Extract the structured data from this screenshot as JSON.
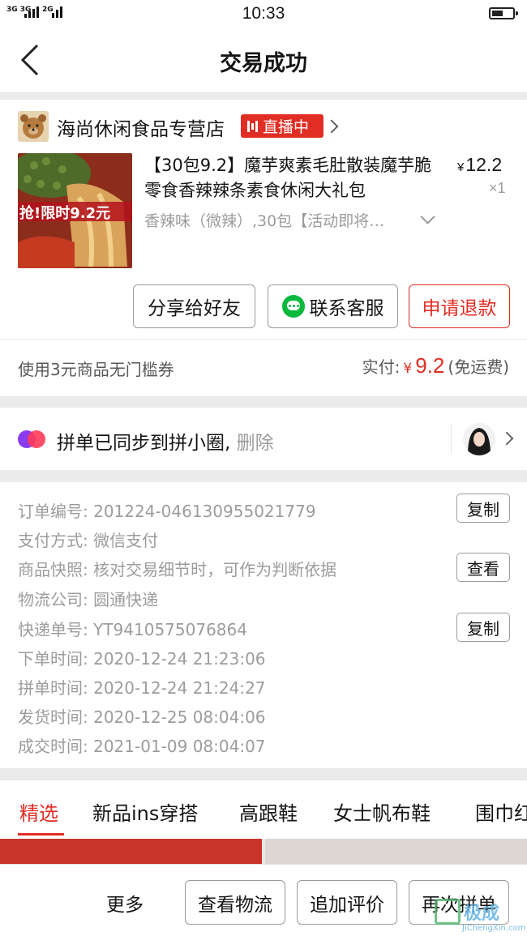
{
  "status_bar": {
    "signal_1": "3G 3G",
    "signal_2": "2G",
    "time": "10:33",
    "battery_icon": "battery-icon"
  },
  "nav": {
    "title": "交易成功",
    "back_icon": "chevron-left-icon"
  },
  "store": {
    "name": "海尚休闲食品专营店",
    "live_label": "直播中"
  },
  "product": {
    "banner": "抢!限时9.2元",
    "title": "【30包9.2】魔芋爽素毛肚散装魔芋脆零食香辣辣条素食休闲大礼包",
    "currency": "¥",
    "price": "12.2",
    "qty": "×1",
    "spec": "香辣味（微辣）,30包【活动即将…"
  },
  "actions": {
    "share": "分享给好友",
    "contact": "联系客服",
    "refund": "申请退款"
  },
  "payment": {
    "coupon": "使用3元商品无门槛券",
    "paid_label": "实付:",
    "currency": "¥",
    "amount": "9.2",
    "shipping": "(免运费)"
  },
  "pinxiaoquan": {
    "text": "拼单已同步到拼小圈,",
    "delete": "删除"
  },
  "order_info": {
    "order_no_label": "订单编号:",
    "order_no": "201224-046130955021779",
    "pay_method_label": "支付方式:",
    "pay_method": "微信支付",
    "snapshot_label": "商品快照:",
    "snapshot": "核对交易细节时，可作为判断依据",
    "logistics_label": "物流公司:",
    "logistics": "圆通快递",
    "tracking_label": "快递单号:",
    "tracking": "YT9410575076864",
    "order_time_label": "下单时间:",
    "order_time": "2020-12-24 21:23:06",
    "group_time_label": "拼单时间:",
    "group_time": "2020-12-24 21:24:27",
    "ship_time_label": "发货时间:",
    "ship_time": "2020-12-25 08:04:06",
    "deal_time_label": "成交时间:",
    "deal_time": "2021-01-09 08:04:07",
    "copy": "复制",
    "view": "查看"
  },
  "tabs": [
    "精选",
    "新品ins穿搭",
    "高跟鞋",
    "女士帆布鞋",
    "围巾红"
  ],
  "bottom": {
    "more": "更多",
    "logistics": "查看物流",
    "review": "追加评价",
    "reorder": "再次拼单"
  },
  "watermark": {
    "text": "极成",
    "sub": "JiChengXin.com"
  },
  "colors": {
    "brand_red": "#e02e24",
    "wechat_green": "#07b83c",
    "muted_text": "#9c9c9c"
  }
}
